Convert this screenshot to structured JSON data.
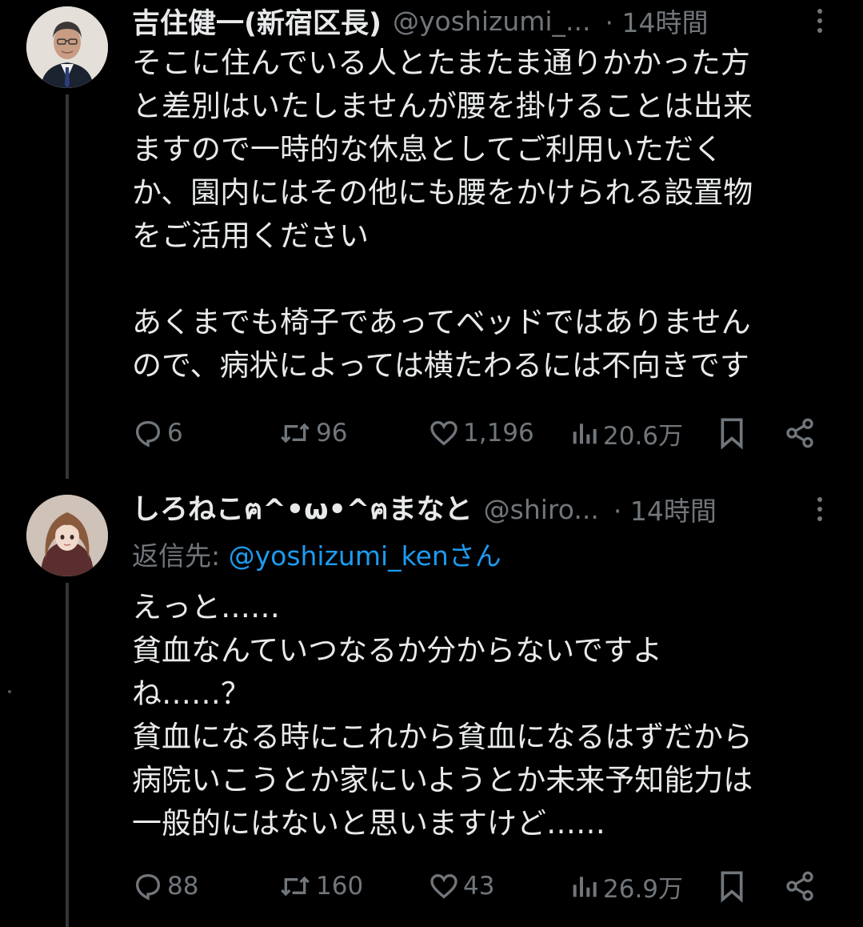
{
  "tweets": [
    {
      "display_name": "吉住健一(新宿区長)",
      "handle": "@yoshizumi_...",
      "time": "· 14時間",
      "text": "そこに住んでいる人とたまたま通りかかった方\nと差別はいたしませんが腰を掛けることは出来\nますので一時的な休息としてご利用いただく\nか、園内にはその他にも腰をかけられる設置物\nをご活用ください\n\nあくまでも椅子であってベッドではありません\nので、病状によっては横たわるには不向きです",
      "replies": "6",
      "retweets": "96",
      "likes": "1,196",
      "views": "20.6万"
    },
    {
      "display_name": "しろねこฅ^•ω•^ฅまなと",
      "handle": "@shiro...",
      "time": "· 14時間",
      "reply_prefix": "返信先: ",
      "reply_mention": "@yoshizumi_kenさん",
      "text": "えっと……\n貧血なんていつなるか分からないですよ\nね……？\n貧血になる時にこれから貧血になるはずだから\n病院いこうとか家にいようとか未来予知能力は\n一般的にはないと思いますけど……",
      "replies": "88",
      "retweets": "160",
      "likes": "43",
      "views": "26.9万"
    }
  ],
  "colors": {
    "background": "#000000",
    "text": "#e7e9ea",
    "secondary": "#71767b",
    "link": "#1d9bf0",
    "thread_line": "#333639"
  },
  "icons": [
    "more-icon",
    "reply-icon",
    "retweet-icon",
    "like-icon",
    "views-icon",
    "bookmark-icon",
    "share-icon"
  ]
}
